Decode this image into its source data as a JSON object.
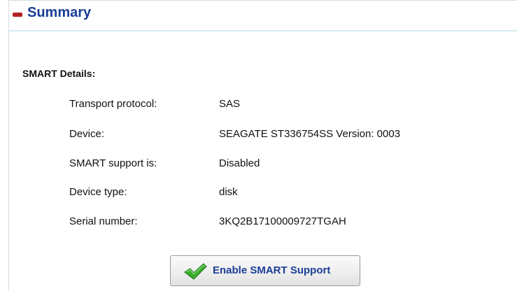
{
  "header": {
    "title": "Summary"
  },
  "smart": {
    "section_title": "SMART Details:",
    "rows": [
      {
        "label": "Transport protocol:",
        "value": "SAS"
      },
      {
        "label": "Device:",
        "value": "SEAGATE ST336754SS Version: 0003"
      },
      {
        "label": "SMART support is:",
        "value": "Disabled"
      },
      {
        "label": "Device type:",
        "value": "disk"
      },
      {
        "label": "Serial number:",
        "value": "3KQ2B17100009727TGAH"
      }
    ]
  },
  "actions": {
    "enable_label": "Enable SMART Support"
  },
  "colors": {
    "title": "#1a3e96",
    "collapse_icon": "#b31f24",
    "check_icon": "#3cae2e"
  },
  "icons": {
    "collapse": "minus-icon",
    "check": "checkmark-icon"
  }
}
